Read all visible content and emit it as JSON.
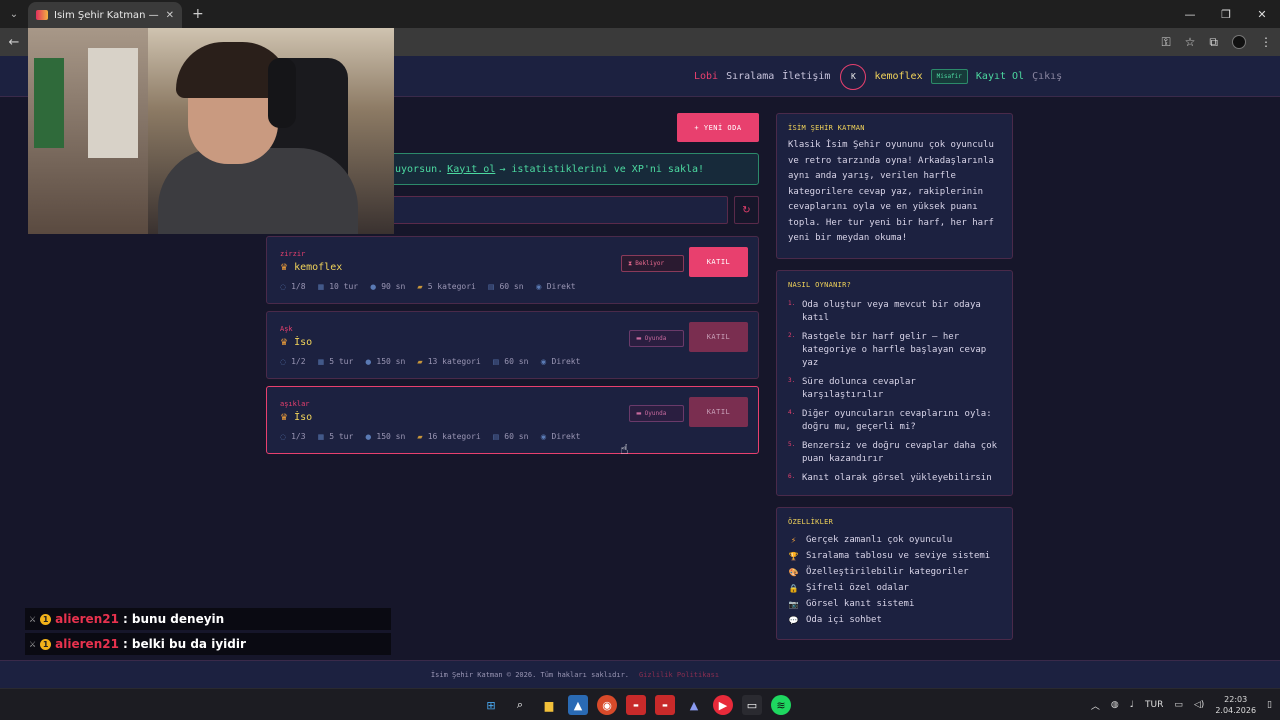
{
  "browser": {
    "tab_title": "İsim Şehir Katman — Multiplayer",
    "tab_close": "✕",
    "new_tab": "+",
    "menu_icon": "chevron-down-icon",
    "window_controls": [
      "—",
      "❐",
      "✕"
    ]
  },
  "header": {
    "nav_lobi": "Lobi",
    "nav_leaderboard": "Sıralama",
    "nav_contact": "İletişim",
    "avatar_initial": "K",
    "username": "kemoflex",
    "guest_badge": "Misafir",
    "register": "Kayıt Ol",
    "logout": "Çıkış"
  },
  "lobby": {
    "new_room_label": "+ YENİ ODA",
    "banner_text": "uyorsun.",
    "banner_link": "Kayıt ol",
    "banner_after": "→ istatistiklerini ve XP'ni sakla!",
    "refresh_icon": "↻",
    "rooms": [
      {
        "name": "zirzir",
        "owner": "kemoflex",
        "status": "Bekliyor",
        "join": "KATIL",
        "players": "1/8",
        "rounds": "10 tur",
        "time": "90 sn",
        "categories": "5 kategori",
        "answer_time": "60 sn",
        "mode": "Direkt"
      },
      {
        "name": "Aşk",
        "owner": "İso",
        "status": "Oyunda",
        "join": "KATIL",
        "players": "1/2",
        "rounds": "5 tur",
        "time": "150 sn",
        "categories": "13 kategori",
        "answer_time": "60 sn",
        "mode": "Direkt"
      },
      {
        "name": "aşıklar",
        "owner": "İso",
        "status": "Oyunda",
        "join": "KATIL",
        "players": "1/3",
        "rounds": "5 tur",
        "time": "150 sn",
        "categories": "16 kategori",
        "answer_time": "60 sn",
        "mode": "Direkt"
      }
    ]
  },
  "sidebar": {
    "about_title": "İSİM ŞEHİR KATMAN",
    "about_text": "Klasik İsim Şehir oyununu çok oyunculu ve retro tarzında oyna! Arkadaşlarınla aynı anda yarış, verilen harfle kategorilere cevap yaz, rakiplerinin cevaplarını oyla ve en yüksek puanı topla. Her tur yeni bir harf, her harf yeni bir meydan okuma!",
    "how_title": "NASIL OYNANIR?",
    "how_steps": [
      "Oda oluştur veya mevcut bir odaya katıl",
      "Rastgele bir harf gelir — her kategoriye o harfle başlayan cevap yaz",
      "Süre dolunca cevaplar karşılaştırılır",
      "Diğer oyuncuların cevaplarını oyla: doğru mu, geçerli mi?",
      "Benzersiz ve doğru cevaplar daha çok puan kazandırır",
      "Kanıt olarak görsel yükleyebilirsin"
    ],
    "how_numbers": [
      "1.",
      "2.",
      "3.",
      "4.",
      "5.",
      "6."
    ],
    "features_title": "ÖZELLİKLER",
    "features": [
      {
        "icon": "⚡",
        "text": "Gerçek zamanlı çok oyunculu"
      },
      {
        "icon": "🏆",
        "text": "Sıralama tablosu ve seviye sistemi"
      },
      {
        "icon": "🎨",
        "text": "Özelleştirilebilir kategoriler"
      },
      {
        "icon": "🔒",
        "text": "Şifreli özel odalar"
      },
      {
        "icon": "📷",
        "text": "Görsel kanıt sistemi"
      },
      {
        "icon": "💬",
        "text": "Oda içi sohbet"
      }
    ]
  },
  "chat": [
    {
      "user": "alieren21",
      "message": ": bunu deneyin"
    },
    {
      "user": "alieren21",
      "message": ": belki bu da iyidir"
    }
  ],
  "footer": {
    "copyright": "İsim Şehir Katman © 2026. Tüm hakları saklıdır.",
    "privacy": "Gizlilik Politikası"
  },
  "taskbar": {
    "language": "TUR",
    "time": "22:03",
    "date": "2.04.2026"
  },
  "colors": {
    "accent": "#e8406e",
    "gold": "#f2d45a",
    "green": "#4cd9a0",
    "background": "#16162a",
    "card": "#1c2140"
  }
}
